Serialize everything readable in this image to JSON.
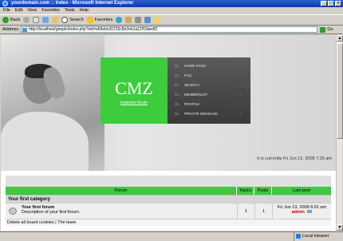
{
  "window": {
    "title": "yourdomain.com :: Index - Microsoft Internet Explorer"
  },
  "menu": [
    "File",
    "Edit",
    "View",
    "Favorites",
    "Tools",
    "Help"
  ],
  "toolbar": {
    "back_label": "Back",
    "search_label": "Search",
    "favorites_label": "Favorites"
  },
  "address": {
    "label": "Address",
    "url": "http://localhost/gneptc/index.php?sid=a69ebcd1215c8e2eb1a12f19aedf2",
    "go_label": "Go"
  },
  "site": {
    "logo_title": "CMZ",
    "logo_sub": "business forum",
    "nav": [
      {
        "num": "01.",
        "label": "HOME PAGE"
      },
      {
        "num": "02.",
        "label": "FAQ"
      },
      {
        "num": "03.",
        "label": "SEARCH"
      },
      {
        "num": "04.",
        "label": "MEMBERLIST"
      },
      {
        "num": "05.",
        "label": "PROFILE"
      },
      {
        "num": "06.",
        "label": "PRIVATE MESSAGE"
      }
    ],
    "nav_chevron": "»",
    "current_time": "It is currently Fri Jun 13, 2008 7:26 am"
  },
  "board": {
    "headers": {
      "forum": "Forum",
      "topics": "Topics",
      "posts": "Posts",
      "last_post": "Last post"
    },
    "category": "Your first category",
    "forum": {
      "name": "Your first forum",
      "description": "Description of your first forum.",
      "topics": "1",
      "posts": "1",
      "last_date": "Fri Jun 13, 2008 6:01 am",
      "last_author": "admin"
    },
    "footer": "Delete all board cookies | The team"
  },
  "status": {
    "left": "",
    "zone": "Local intranet"
  }
}
